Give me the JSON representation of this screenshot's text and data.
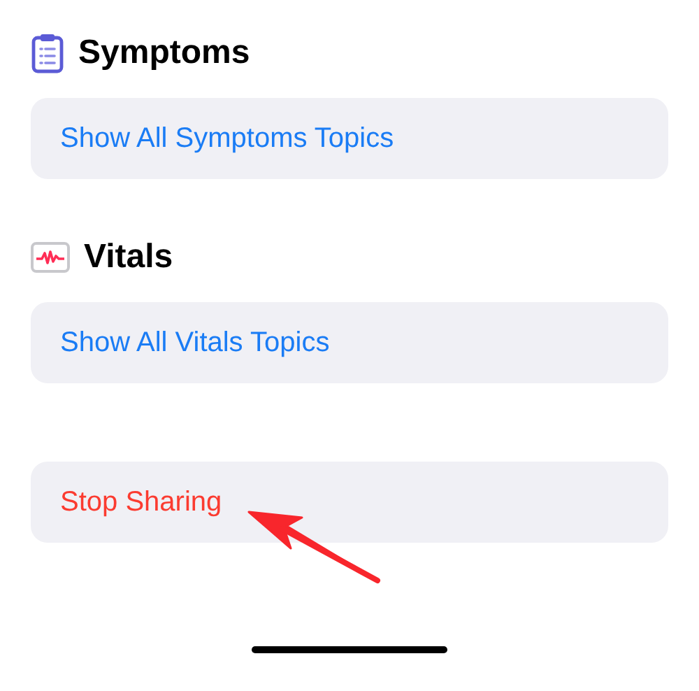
{
  "sections": [
    {
      "kind": "symptoms",
      "title": "Symptoms",
      "link": "Show All Symptoms Topics"
    },
    {
      "kind": "vitals",
      "title": "Vitals",
      "link": "Show All Vitals Topics"
    }
  ],
  "action": {
    "kind": "destructive",
    "label": "Stop Sharing"
  }
}
